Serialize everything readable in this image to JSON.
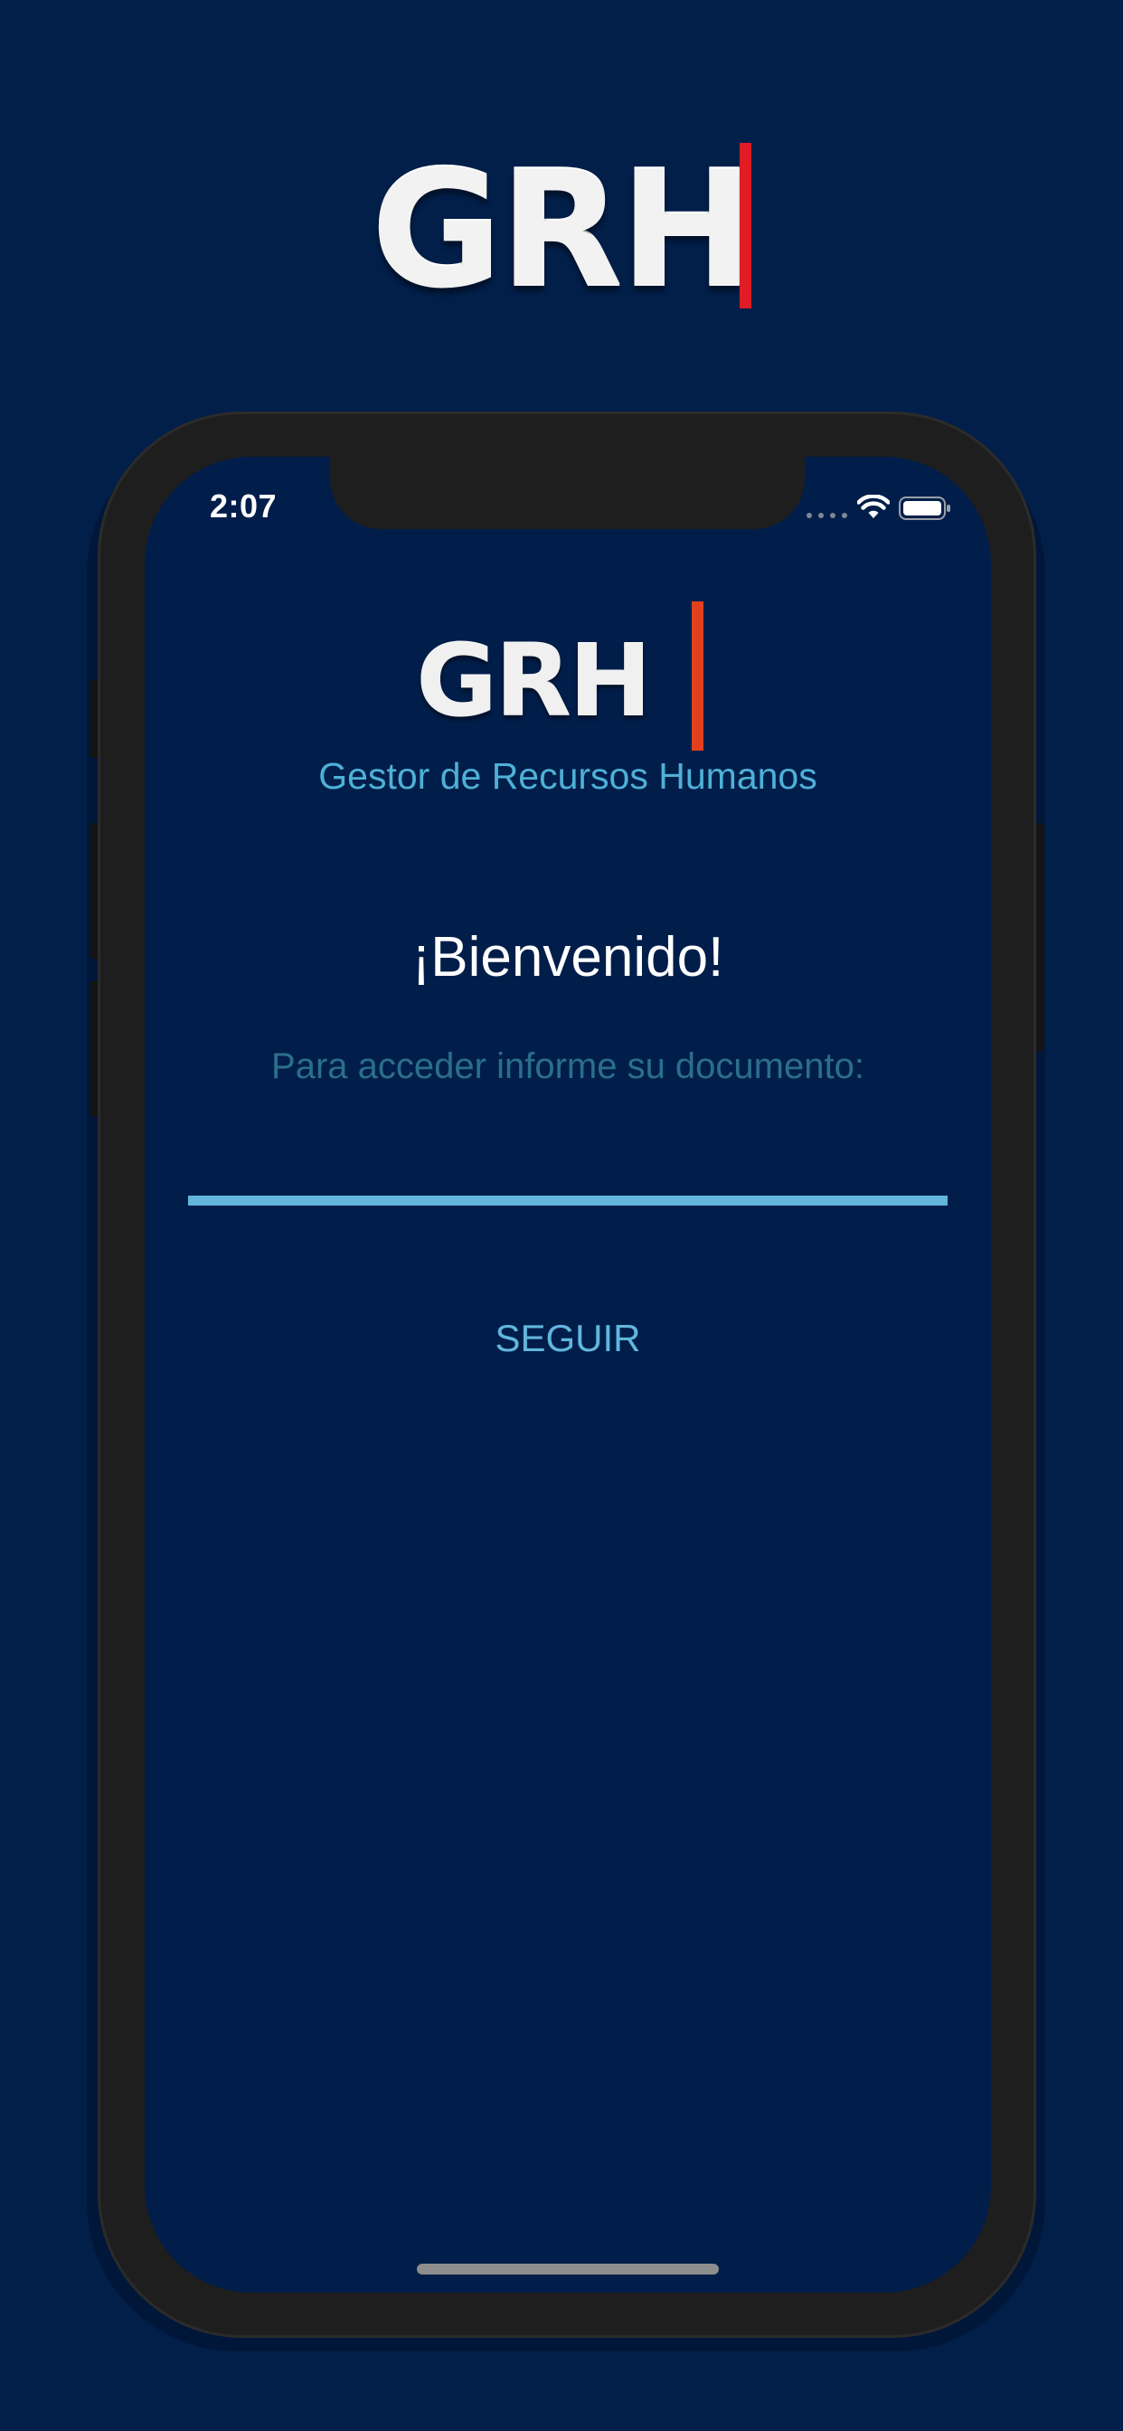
{
  "brand": {
    "top_logo_text": "GRH",
    "accent_color": "#e01c24",
    "background_color": "#021f4a"
  },
  "status_bar": {
    "time": "2:07",
    "icons": [
      "signal-icon",
      "wifi-icon",
      "battery-icon"
    ]
  },
  "app": {
    "logo_text": "GRH",
    "subtitle": "Gestor de Recursos Humanos",
    "welcome": "¡Bienvenido!",
    "instruction": "Para acceder informe su documento:",
    "document_input": {
      "value": "",
      "placeholder": ""
    },
    "continue_label": "SEGUIR",
    "accent_color": "#62b6dc"
  }
}
